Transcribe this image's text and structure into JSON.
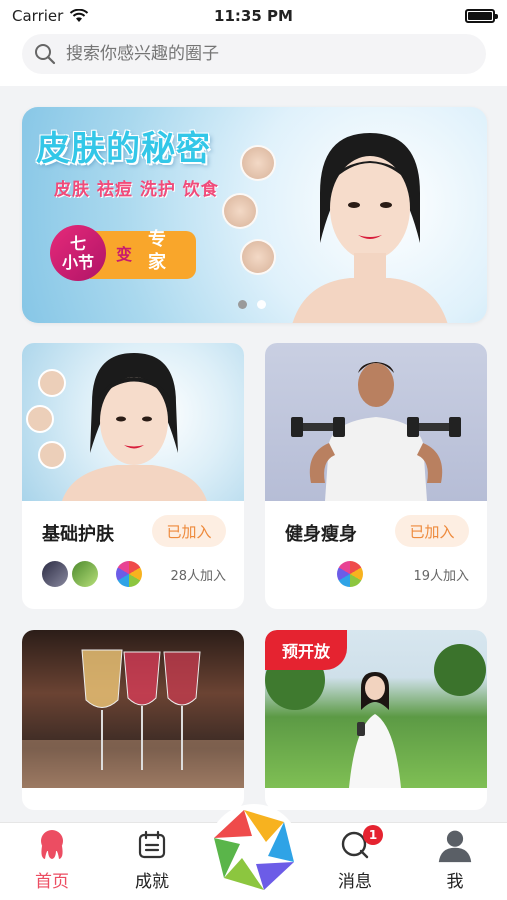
{
  "status_bar": {
    "carrier": "Carrier",
    "time": "11:35 PM"
  },
  "search": {
    "placeholder": "搜索你感兴趣的圈子"
  },
  "banner": {
    "title": "皮肤的秘密",
    "subtitle": "皮肤 祛痘 洗护 饮食",
    "circle_line1": "七",
    "circle_line2": "小节",
    "change": "变",
    "expert": "专家",
    "page_count": 2,
    "active_page": 1
  },
  "groups": [
    {
      "name": "基础护肤",
      "join_label": "已加入",
      "count_text": "28人加入"
    },
    {
      "name": "健身瘦身",
      "join_label": "已加入",
      "count_text": "19人加入"
    },
    {
      "name": "",
      "join_label": "",
      "count_text": ""
    },
    {
      "name": "",
      "join_label": "",
      "count_text": "",
      "badge": "预开放"
    }
  ],
  "tabs": [
    {
      "label": "首页",
      "icon": "octopus-icon",
      "active": true
    },
    {
      "label": "成就",
      "icon": "calendar-icon"
    },
    {
      "label": "",
      "icon": "aperture-icon"
    },
    {
      "label": "消息",
      "icon": "chat-bubble-icon",
      "badge": "1"
    },
    {
      "label": "我",
      "icon": "person-icon"
    }
  ],
  "colors": {
    "accent": "#ec4d62",
    "join_bg": "#fdeee2",
    "join_text": "#ee8a3c",
    "badge_red": "#e52330"
  }
}
